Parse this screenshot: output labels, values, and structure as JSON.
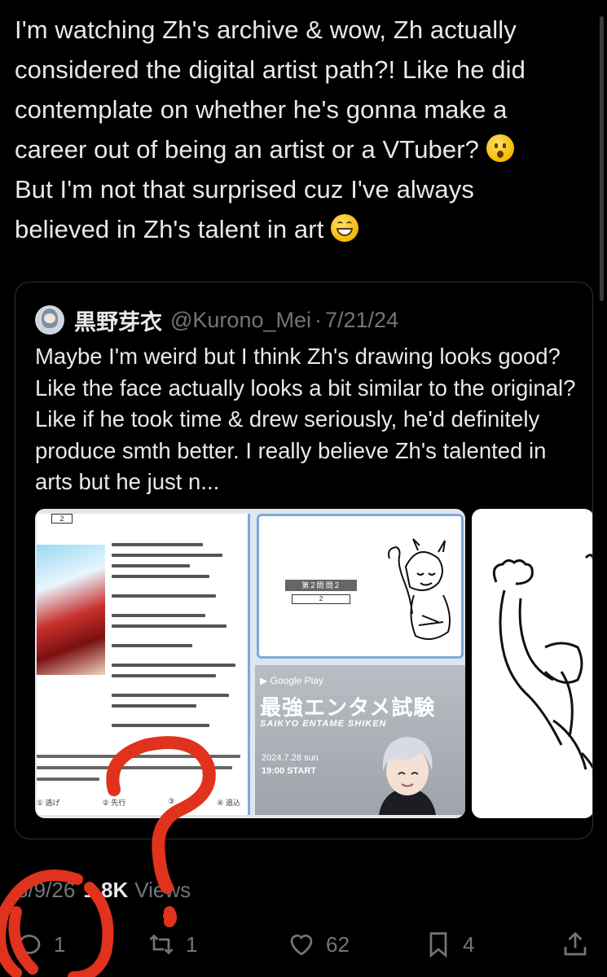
{
  "tweet": {
    "line1": "I'm watching Zh's archive & wow, Zh actually",
    "line2": "considered the digital artist path?! Like he did",
    "line3": "contemplate on whether he's gonna make a",
    "line4": "career out of being an artist or a VTuber?",
    "line5": "But I'm not that surprised cuz I've always",
    "line6": "believed in Zh's talent in art",
    "emoji1": "hushed-face-icon",
    "emoji2": "grinning-face-icon"
  },
  "quote": {
    "name": "黒野芽衣",
    "handle": "@Kurono_Mei",
    "separator": "·",
    "date": "7/21/24",
    "text": "Maybe I'm weird but I think Zh's drawing looks good? Like the face actually looks a bit similar to the original? Like if he took time & drew seriously, he'd definitely produce smth better. I really believe Zh's talented in arts but he just n...",
    "media1": {
      "page_box": "2",
      "sheet_label": "第２問 問２",
      "sheet_field": "2",
      "store_label": "Google Play",
      "promo_title": "最強エンタメ試験",
      "promo_sub": "SAIKYO ENTAME SHIKEN",
      "promo_date": "2024.7.28 sun",
      "promo_time": "19:00 START",
      "choices": [
        "① 逃げ",
        "② 先行",
        "③",
        "④ 追込"
      ]
    }
  },
  "meta": {
    "time": "3/9/26",
    "views_count": "1.8K",
    "views_label": "Views"
  },
  "actions": {
    "reply_count": "1",
    "retweet_count": "1",
    "like_count": "62",
    "bookmark_count": "4"
  },
  "colors": {
    "background": "#000000",
    "text": "#e7e9ea",
    "muted": "#71767b",
    "border": "#2f3336",
    "annotation_red": "#e0321c"
  }
}
